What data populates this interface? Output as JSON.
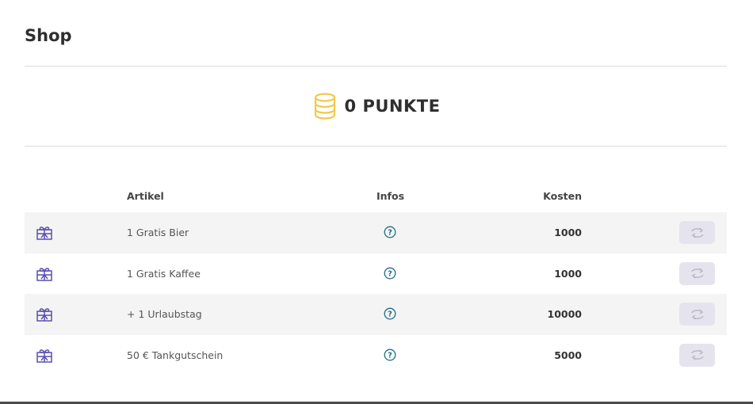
{
  "page": {
    "title": "Shop"
  },
  "points": {
    "value": "0 PUNKTE",
    "icon": "coins-stack-icon",
    "icon_color": "#f2c94c"
  },
  "table": {
    "headers": {
      "artikel": "Artikel",
      "infos": "Infos",
      "kosten": "Kosten"
    },
    "rows": [
      {
        "name": "1 Gratis Bier",
        "cost": "1000",
        "icon": "gift-icon",
        "info_icon": "help-circle-icon",
        "action_icon": "exchange-icon"
      },
      {
        "name": "1 Gratis Kaffee",
        "cost": "1000",
        "icon": "gift-icon",
        "info_icon": "help-circle-icon",
        "action_icon": "exchange-icon"
      },
      {
        "name": "+ 1 Urlaubstag",
        "cost": "10000",
        "icon": "gift-icon",
        "info_icon": "help-circle-icon",
        "action_icon": "exchange-icon"
      },
      {
        "name": "50 € Tankgutschein",
        "cost": "5000",
        "icon": "gift-icon",
        "info_icon": "help-circle-icon",
        "action_icon": "exchange-icon"
      }
    ]
  },
  "colors": {
    "gift_icon": "#5b4fb0",
    "info_icon": "#1f6d8a",
    "redeem_button_bg": "#e5e4ee",
    "redeem_icon": "#b9b8c6",
    "row_shade": "#f4f4f4"
  }
}
